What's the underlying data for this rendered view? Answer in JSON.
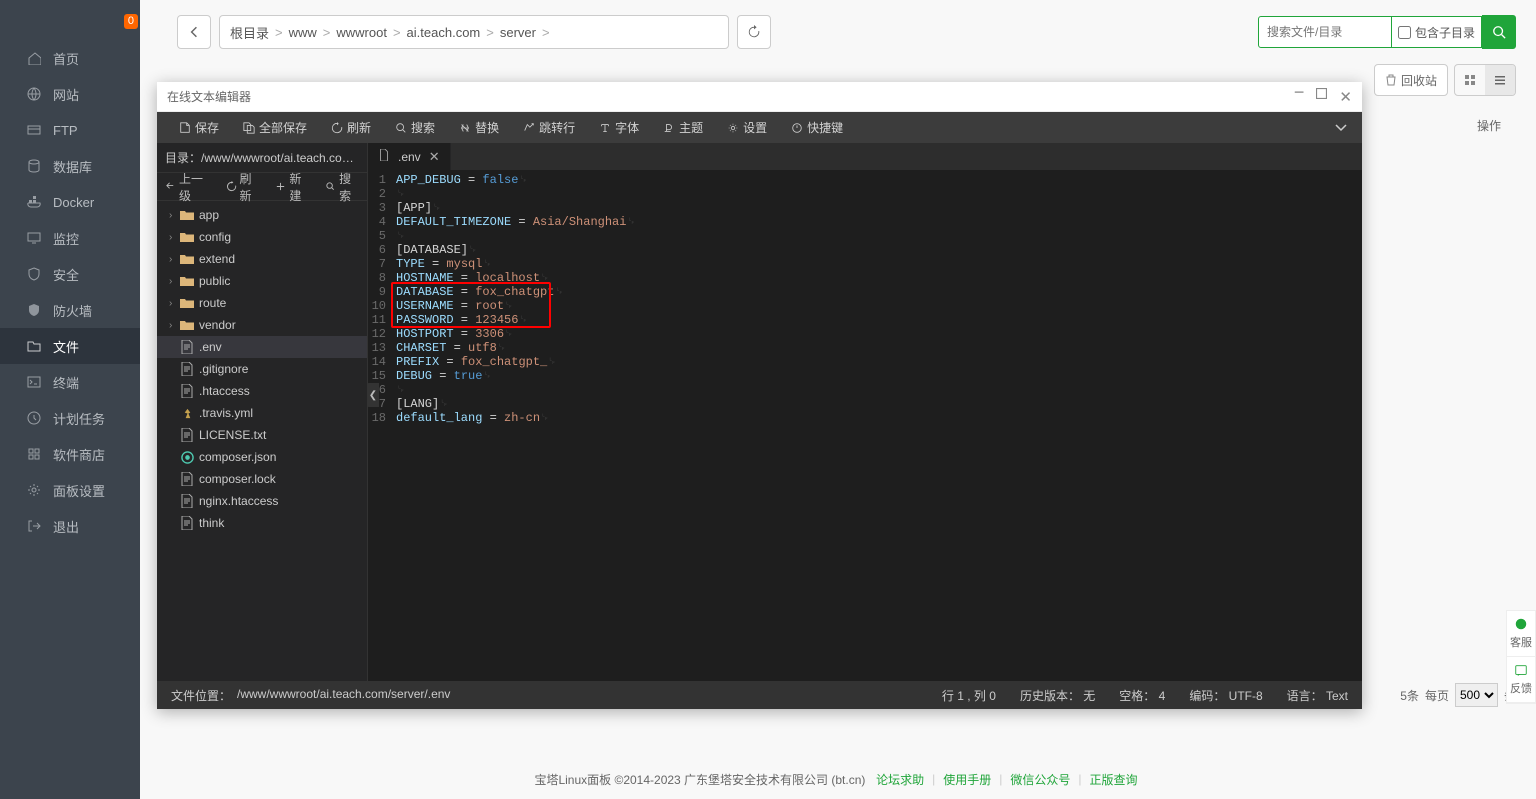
{
  "sidebar": {
    "badge": "0",
    "items": [
      {
        "label": "首页",
        "icon": "home"
      },
      {
        "label": "网站",
        "icon": "globe"
      },
      {
        "label": "FTP",
        "icon": "ftp"
      },
      {
        "label": "数据库",
        "icon": "db"
      },
      {
        "label": "Docker",
        "icon": "docker"
      },
      {
        "label": "监控",
        "icon": "monitor"
      },
      {
        "label": "安全",
        "icon": "shield"
      },
      {
        "label": "防火墙",
        "icon": "firewall"
      },
      {
        "label": "文件",
        "icon": "folder",
        "active": true
      },
      {
        "label": "终端",
        "icon": "terminal"
      },
      {
        "label": "计划任务",
        "icon": "cron"
      },
      {
        "label": "软件商店",
        "icon": "store"
      },
      {
        "label": "面板设置",
        "icon": "settings"
      },
      {
        "label": "退出",
        "icon": "logout"
      }
    ]
  },
  "breadcrumb": {
    "parts": [
      "根目录",
      "www",
      "wwwroot",
      "ai.teach.com",
      "server"
    ]
  },
  "search": {
    "placeholder": "搜索文件/目录",
    "include_sub": "包含子目录"
  },
  "topbar": {
    "recycle": "回收站"
  },
  "col_header": "操作",
  "page_bar": {
    "count_suffix": "5条",
    "per_page": "每页",
    "per_value": "500",
    "unit": "条"
  },
  "editor": {
    "title": "在线文本编辑器",
    "toolbar": [
      "保存",
      "全部保存",
      "刷新",
      "搜索",
      "替换",
      "跳转行",
      "字体",
      "主题",
      "设置",
      "快捷键"
    ],
    "dir_label": "目录：",
    "dir_path": "/www/wwwroot/ai.teach.com/se...",
    "fp_actions": [
      "上一级",
      "刷新",
      "新建",
      "搜索"
    ],
    "tree": [
      {
        "type": "folder",
        "name": "app"
      },
      {
        "type": "folder",
        "name": "config"
      },
      {
        "type": "folder",
        "name": "extend"
      },
      {
        "type": "folder",
        "name": "public"
      },
      {
        "type": "folder",
        "name": "route"
      },
      {
        "type": "folder",
        "name": "vendor"
      },
      {
        "type": "file",
        "name": ".env",
        "selected": true
      },
      {
        "type": "file",
        "name": ".gitignore"
      },
      {
        "type": "file",
        "name": ".htaccess"
      },
      {
        "type": "file",
        "name": ".travis.yml"
      },
      {
        "type": "file",
        "name": "LICENSE.txt"
      },
      {
        "type": "file",
        "name": "composer.json"
      },
      {
        "type": "file",
        "name": "composer.lock"
      },
      {
        "type": "file",
        "name": "nginx.htaccess"
      },
      {
        "type": "file",
        "name": "think"
      }
    ],
    "tab": {
      "name": ".env"
    },
    "code": [
      "APP_DEBUG = false",
      "",
      "[APP]",
      "DEFAULT_TIMEZONE = Asia/Shanghai",
      "",
      "[DATABASE]",
      "TYPE = mysql",
      "HOSTNAME = localhost",
      "DATABASE = fox_chatgpt",
      "USERNAME = root",
      "PASSWORD = 123456",
      "HOSTPORT = 3306",
      "CHARSET = utf8",
      "PREFIX = fox_chatgpt_",
      "DEBUG = true",
      "",
      "[LANG]",
      "default_lang = zh-cn"
    ],
    "highlight_lines": [
      9,
      10,
      11
    ],
    "status": {
      "loc_label": "文件位置：",
      "loc": "/www/wwwroot/ai.teach.com/server/.env",
      "cursor": "行 1 , 列 0",
      "history": "历史版本： 无",
      "spaces": "空格： 4",
      "encoding": "编码： UTF-8",
      "lang": "语言： Text"
    }
  },
  "footer": {
    "copyright": "宝塔Linux面板 ©2014-2023 广东堡塔安全技术有限公司 (bt.cn)",
    "links": [
      "论坛求助",
      "使用手册",
      "微信公众号",
      "正版查询"
    ]
  },
  "float": [
    "客服",
    "反馈"
  ]
}
